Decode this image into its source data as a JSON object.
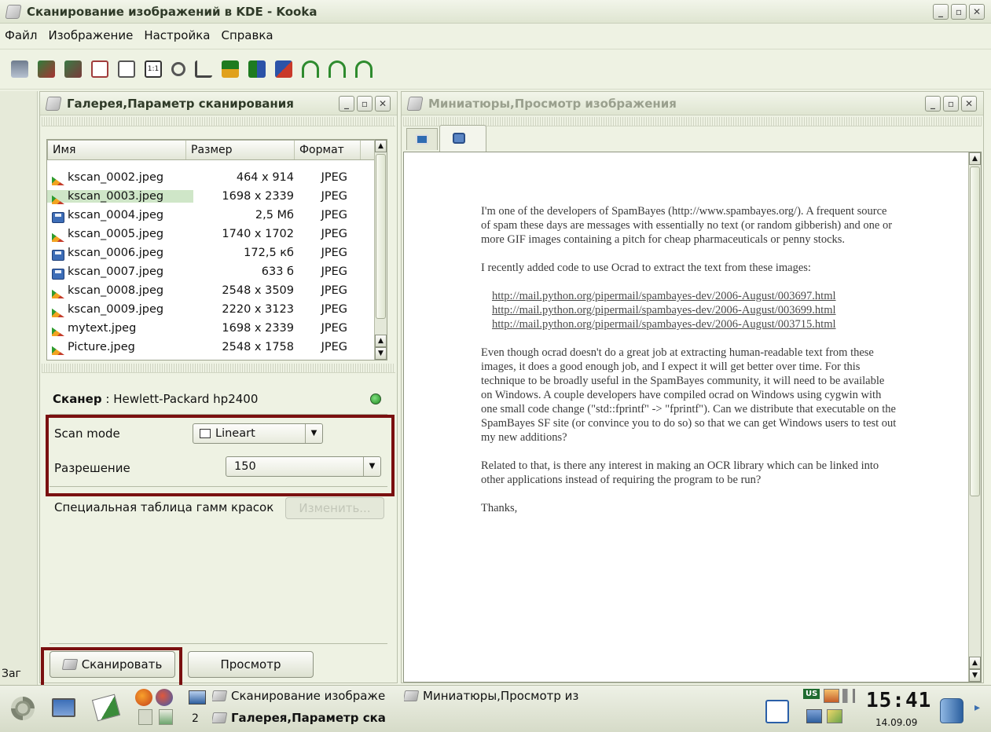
{
  "window": {
    "title": "Сканирование изображений в KDE - Kooka"
  },
  "menu": [
    "Файл",
    "Изображение",
    "Настройка",
    "Справка"
  ],
  "gallery_panel": {
    "title": "Галерея,Параметр сканирования",
    "columns": [
      "Имя",
      "Размер",
      "Формат"
    ],
    "rows": [
      {
        "name": "kscan_0002.jpeg",
        "size": "464 x 914",
        "format": "JPEG",
        "icon": "image"
      },
      {
        "name": "kscan_0003.jpeg",
        "size": "1698 x 2339",
        "format": "JPEG",
        "icon": "image"
      },
      {
        "name": "kscan_0004.jpeg",
        "size": "2,5 Мб",
        "format": "JPEG",
        "icon": "disk"
      },
      {
        "name": "kscan_0005.jpeg",
        "size": "1740 x 1702",
        "format": "JPEG",
        "icon": "image"
      },
      {
        "name": "kscan_0006.jpeg",
        "size": "172,5 кб",
        "format": "JPEG",
        "icon": "disk"
      },
      {
        "name": "kscan_0007.jpeg",
        "size": "633 б",
        "format": "JPEG",
        "icon": "disk"
      },
      {
        "name": "kscan_0008.jpeg",
        "size": "2548 x 3509",
        "format": "JPEG",
        "icon": "image"
      },
      {
        "name": "kscan_0009.jpeg",
        "size": "2220 x 3123",
        "format": "JPEG",
        "icon": "image"
      },
      {
        "name": "mytext.jpeg",
        "size": "1698 x 2339",
        "format": "JPEG",
        "icon": "image"
      },
      {
        "name": "Picture.jpeg",
        "size": "2548 x 1758",
        "format": "JPEG",
        "icon": "image"
      }
    ]
  },
  "scanner": {
    "label": "Сканер",
    "name": ": Hewlett-Packard hp2400",
    "scan_mode_label": "Scan mode",
    "scan_mode_value": "Lineart",
    "resolution_label": "Разрешение",
    "resolution_value": "150",
    "gamma_label": "Специальная таблица гамм красок",
    "gamma_button": "Изменить...",
    "scan_button": "Сканировать",
    "preview_button": "Просмотр",
    "truncated_side_label": "Заг"
  },
  "preview_panel": {
    "title": "Миниатюры,Просмотр изображения",
    "document": {
      "p1": "I'm one of the developers of SpamBayes (http://www.spambayes.org/). A frequent source of spam these days are messages with essentially no text (or random gibberish) and one or more GIF images containing a pitch for cheap pharmaceuticals or penny stocks.",
      "p2": "I recently added code to use Ocrad to extract the text from these images:",
      "links": [
        "http://mail.python.org/pipermail/spambayes-dev/2006-August/003697.html",
        "http://mail.python.org/pipermail/spambayes-dev/2006-August/003699.html",
        "http://mail.python.org/pipermail/spambayes-dev/2006-August/003715.html"
      ],
      "p3": "Even though ocrad doesn't do a great job at extracting human-readable text from these images, it does a good enough job, and I expect it will get better over time. For this technique to be broadly useful in the SpamBayes community, it will need to be available on Windows. A couple developers have compiled ocrad on Windows using cygwin with one small code change (\"std::fprintf\" -> \"fprintf\"). Can we distribute that executable on the SpamBayes SF site (or convince you to do so) so that we can get Windows users to test out my new additions?",
      "p4": "Related to that, is there any interest in making an OCR library which can be linked into other applications instead of requiring the program to be run?",
      "p5": "Thanks,"
    }
  },
  "taskbar": {
    "tasks": [
      "Сканирование изображе",
      "Миниатюры,Просмотр из",
      "Галерея,Параметр ска"
    ],
    "desktop_number": "2",
    "keyboard_layout": "US",
    "clock": "15:41",
    "date": "14.09.09"
  }
}
